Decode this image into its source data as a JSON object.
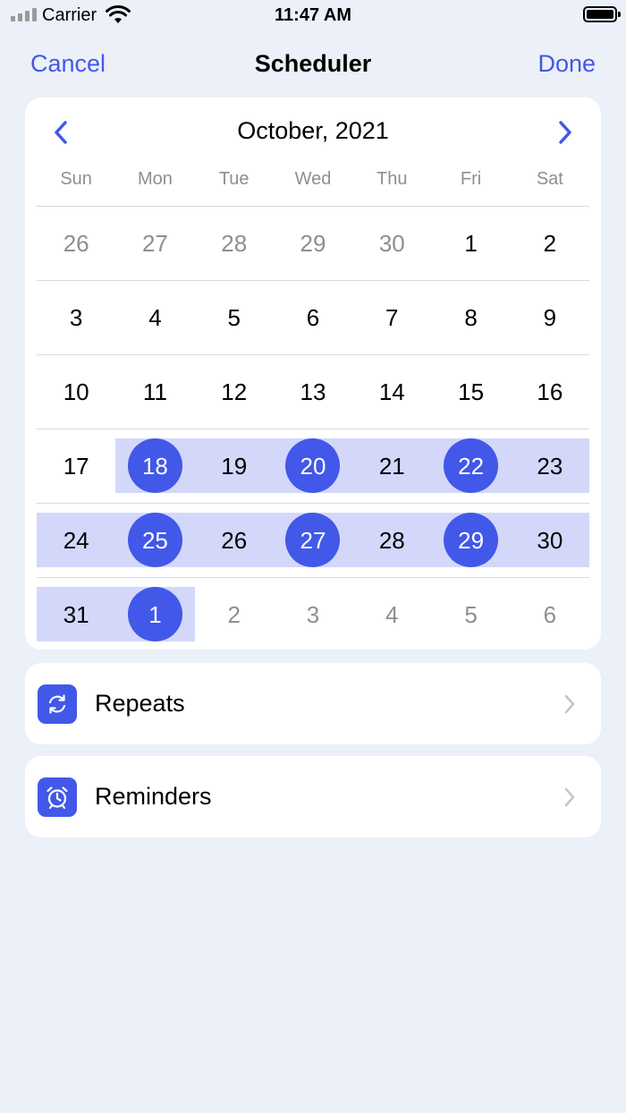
{
  "status_bar": {
    "carrier": "Carrier",
    "time": "11:47 AM"
  },
  "nav": {
    "cancel": "Cancel",
    "title": "Scheduler",
    "done": "Done"
  },
  "calendar": {
    "month_title": "October, 2021",
    "weekdays": [
      "Sun",
      "Mon",
      "Tue",
      "Wed",
      "Thu",
      "Fri",
      "Sat"
    ],
    "weeks": [
      [
        {
          "d": "26",
          "m": true
        },
        {
          "d": "27",
          "m": true
        },
        {
          "d": "28",
          "m": true
        },
        {
          "d": "29",
          "m": true
        },
        {
          "d": "30",
          "m": true
        },
        {
          "d": "1"
        },
        {
          "d": "2"
        }
      ],
      [
        {
          "d": "3"
        },
        {
          "d": "4"
        },
        {
          "d": "5"
        },
        {
          "d": "6"
        },
        {
          "d": "7"
        },
        {
          "d": "8"
        },
        {
          "d": "9"
        }
      ],
      [
        {
          "d": "10"
        },
        {
          "d": "11"
        },
        {
          "d": "12"
        },
        {
          "d": "13"
        },
        {
          "d": "14"
        },
        {
          "d": "15"
        },
        {
          "d": "16"
        }
      ],
      [
        {
          "d": "17"
        },
        {
          "d": "18",
          "s": true
        },
        {
          "d": "19"
        },
        {
          "d": "20",
          "s": true
        },
        {
          "d": "21"
        },
        {
          "d": "22",
          "s": true
        },
        {
          "d": "23"
        }
      ],
      [
        {
          "d": "24"
        },
        {
          "d": "25",
          "s": true
        },
        {
          "d": "26"
        },
        {
          "d": "27",
          "s": true
        },
        {
          "d": "28"
        },
        {
          "d": "29",
          "s": true
        },
        {
          "d": "30"
        }
      ],
      [
        {
          "d": "31"
        },
        {
          "d": "1",
          "s": true
        },
        {
          "d": "2",
          "m": true
        },
        {
          "d": "3",
          "m": true
        },
        {
          "d": "4",
          "m": true
        },
        {
          "d": "5",
          "m": true
        },
        {
          "d": "6",
          "m": true
        }
      ]
    ],
    "range_bands": [
      {
        "week": 3,
        "from": 1,
        "to": 6
      },
      {
        "week": 4,
        "from": 0,
        "to": 6
      },
      {
        "week": 5,
        "from": 0,
        "to": 1
      }
    ]
  },
  "options": {
    "repeats": {
      "label": "Repeats",
      "icon": "repeat-icon"
    },
    "reminders": {
      "label": "Reminders",
      "icon": "alarm-clock-icon"
    }
  },
  "colors": {
    "accent": "#4258e8",
    "range": "#d3d8fa",
    "background": "#ecf0f8"
  }
}
